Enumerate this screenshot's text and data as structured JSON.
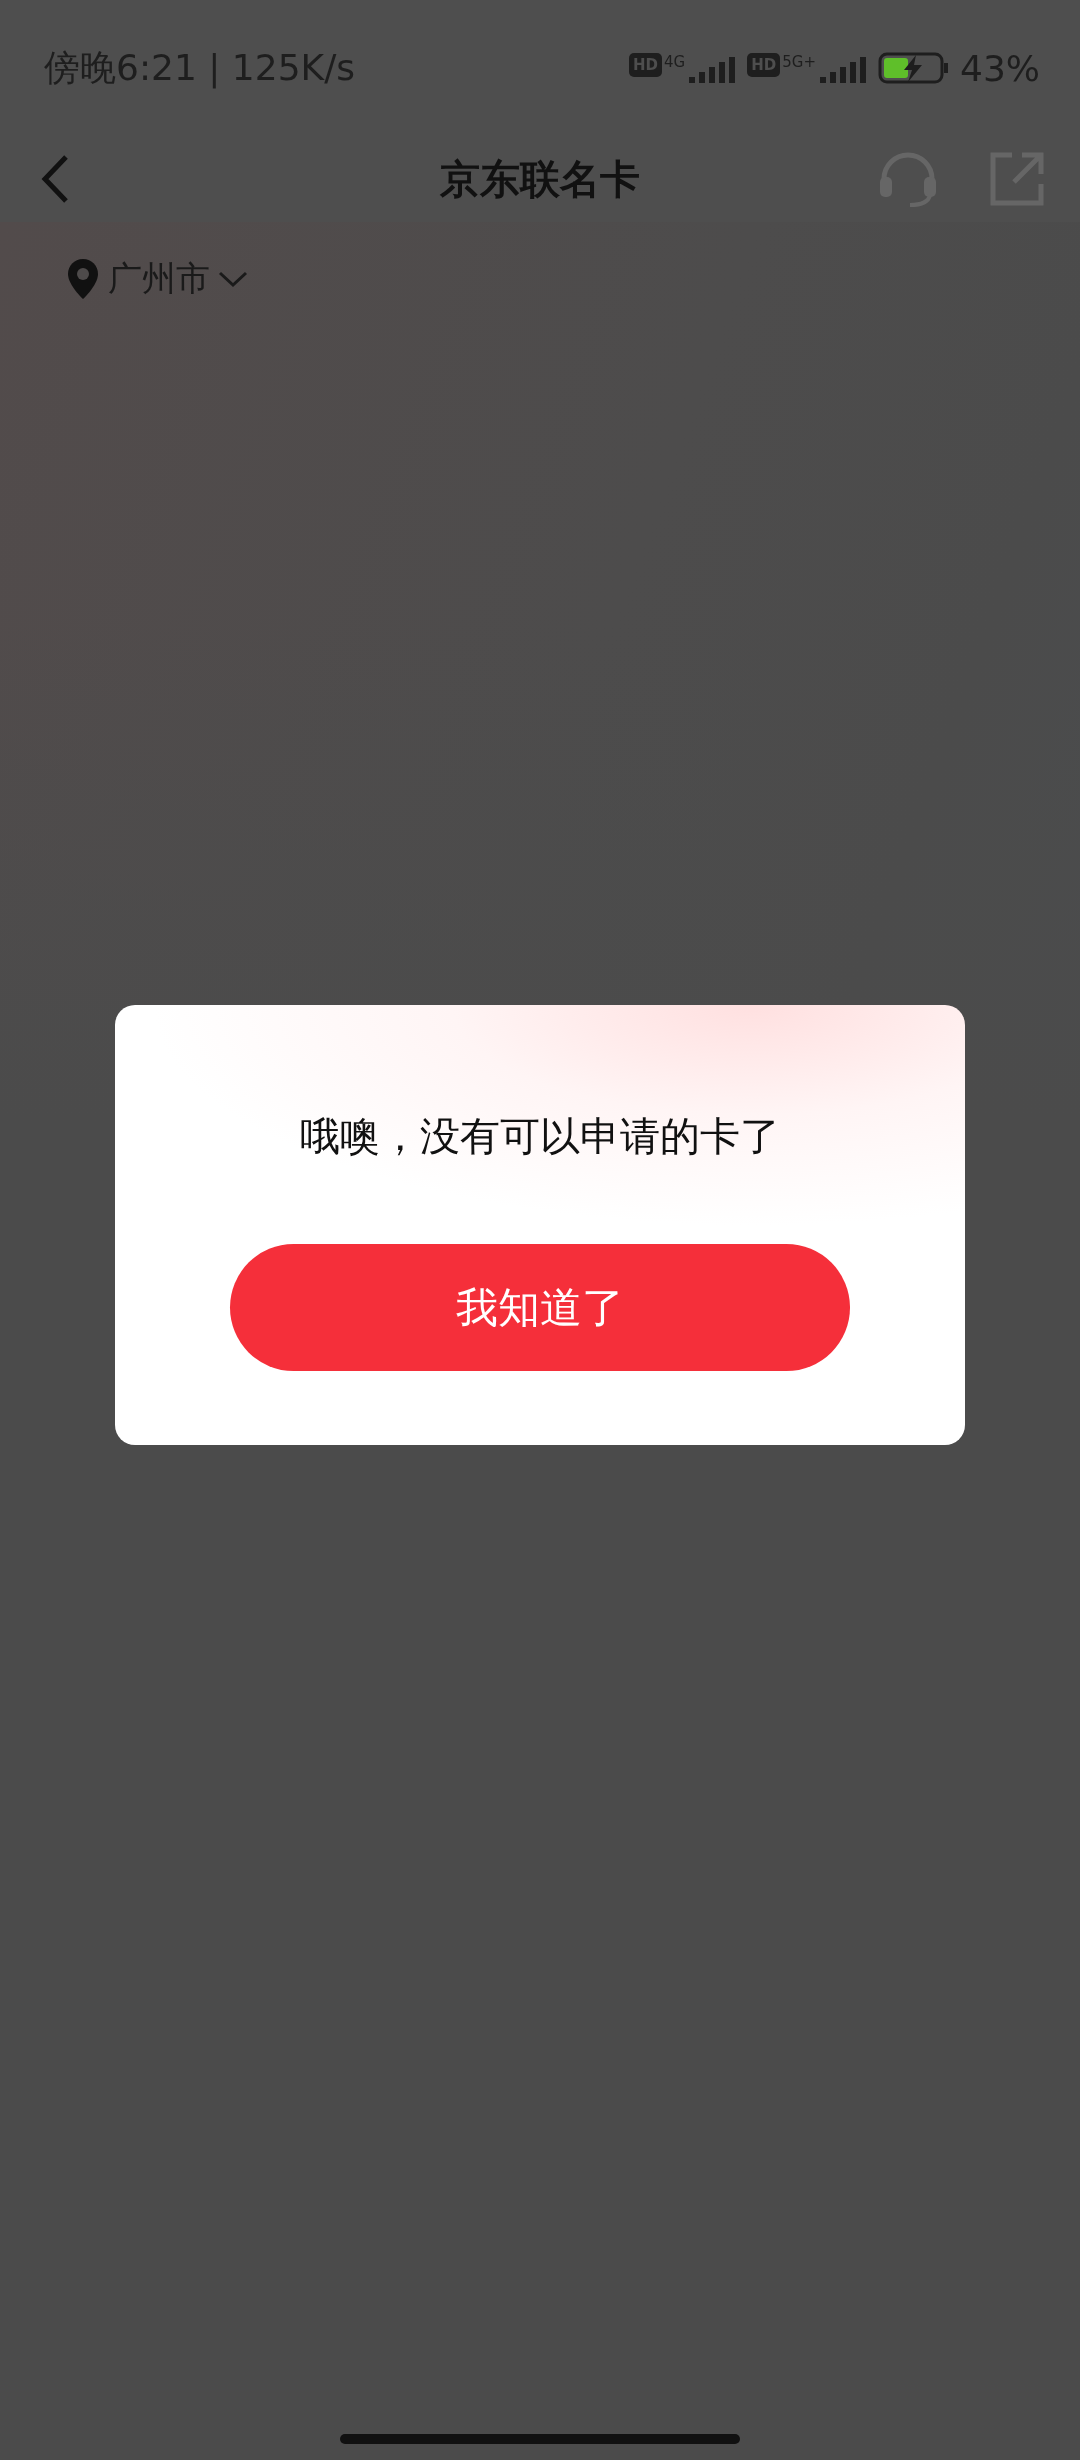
{
  "status_bar": {
    "time": "傍晚6:21 | 125K/s",
    "sim1": {
      "badge": "HD",
      "network": "4G"
    },
    "sim2": {
      "badge": "HD",
      "network": "5G+"
    },
    "battery": "43%",
    "charging": true
  },
  "nav": {
    "title": "京东联名卡"
  },
  "location": {
    "city": "广州市"
  },
  "dialog": {
    "message": "哦噢，没有可以申请的卡了",
    "button": "我知道了"
  }
}
